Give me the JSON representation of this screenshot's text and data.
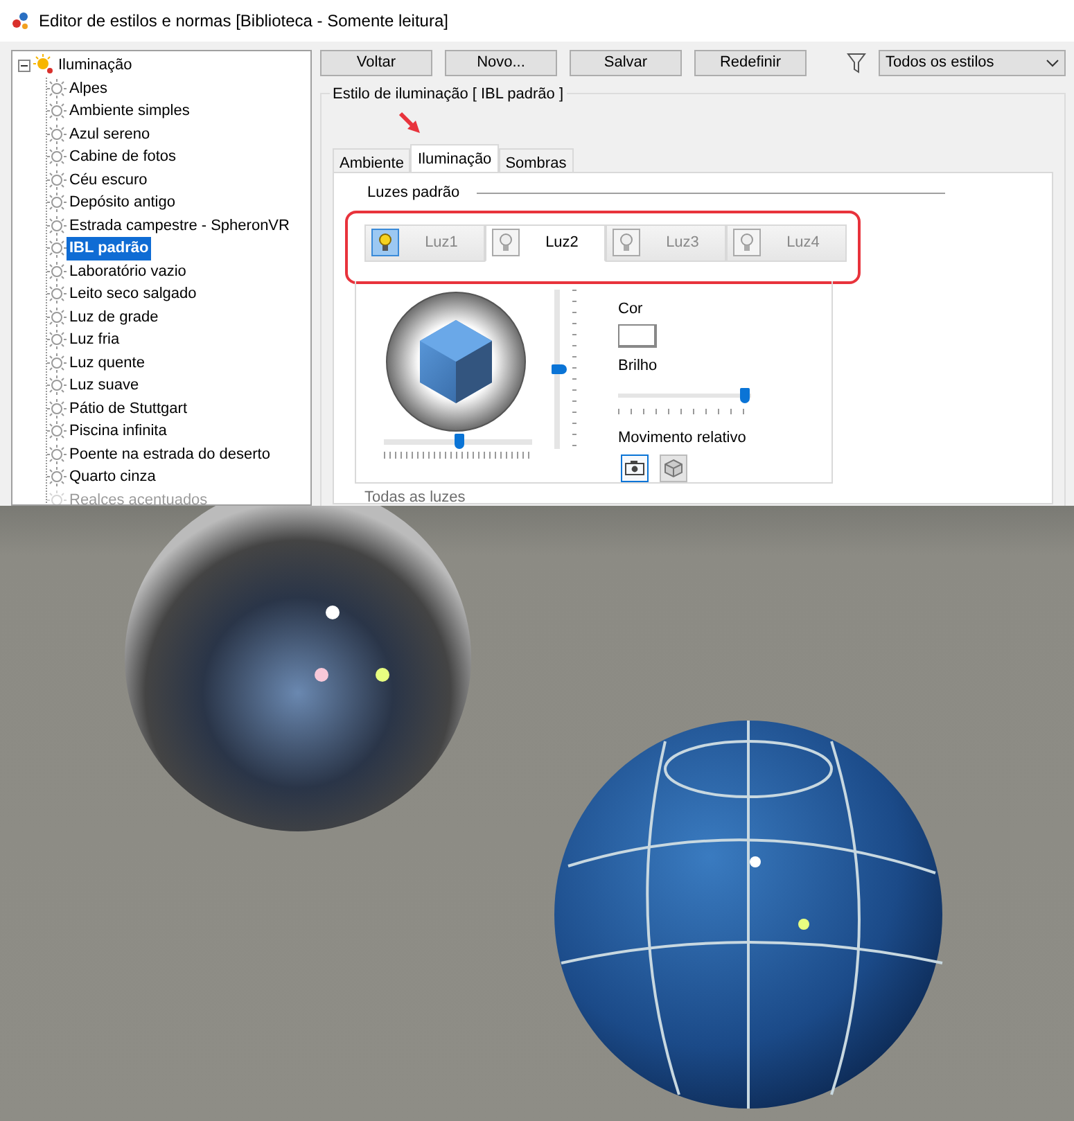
{
  "window": {
    "title": "Editor de estilos e normas [Biblioteca - Somente leitura]"
  },
  "tree": {
    "label": "Iluminação",
    "expanded": true,
    "children": [
      {
        "label": "Alpes",
        "selected": false
      },
      {
        "label": "Ambiente simples",
        "selected": false
      },
      {
        "label": "Azul sereno",
        "selected": false
      },
      {
        "label": "Cabine de fotos",
        "selected": false
      },
      {
        "label": "Céu escuro",
        "selected": false
      },
      {
        "label": "Depósito antigo",
        "selected": false
      },
      {
        "label": "Estrada campestre - SpheronVR",
        "selected": false
      },
      {
        "label": "IBL padrão",
        "selected": true
      },
      {
        "label": "Laboratório vazio",
        "selected": false
      },
      {
        "label": "Leito seco salgado",
        "selected": false
      },
      {
        "label": "Luz de grade",
        "selected": false
      },
      {
        "label": "Luz fria",
        "selected": false
      },
      {
        "label": "Luz quente",
        "selected": false
      },
      {
        "label": "Luz suave",
        "selected": false
      },
      {
        "label": "Pátio de Stuttgart",
        "selected": false
      },
      {
        "label": "Piscina infinita",
        "selected": false
      },
      {
        "label": "Poente na estrada do deserto",
        "selected": false
      },
      {
        "label": "Quarto cinza",
        "selected": false
      },
      {
        "label": "Realces acentuados",
        "selected": false
      }
    ]
  },
  "toolbar": {
    "buttons": [
      "Voltar",
      "Novo...",
      "Salvar",
      "Redefinir"
    ],
    "filter": {
      "value": "Todos os estilos"
    }
  },
  "style_group": {
    "title": "Estilo de iluminação [ IBL padrão ]"
  },
  "tabs": [
    {
      "label": "Ambiente",
      "selected": false
    },
    {
      "label": "Iluminação",
      "selected": true
    },
    {
      "label": "Sombras",
      "selected": false
    }
  ],
  "default_lights": {
    "title": "Luzes padrão",
    "lights": [
      {
        "label": "Luz1",
        "on": true,
        "selected": false
      },
      {
        "label": "Luz2",
        "on": false,
        "selected": true
      },
      {
        "label": "Luz3",
        "on": false,
        "selected": false
      },
      {
        "label": "Luz4",
        "on": false,
        "selected": false
      }
    ],
    "elevation": {
      "level": 0.5
    },
    "rotation": {
      "level": 0.5
    },
    "color": {
      "label": "Cor"
    },
    "brightness": {
      "label": "Brilho",
      "level": 0.95
    },
    "relative_movement": {
      "label": "Movimento relativo",
      "options": [
        {
          "kind": "camera",
          "selected": true
        },
        {
          "kind": "model",
          "selected": false
        }
      ]
    }
  },
  "all_lights": {
    "title": "Todas as luzes"
  }
}
